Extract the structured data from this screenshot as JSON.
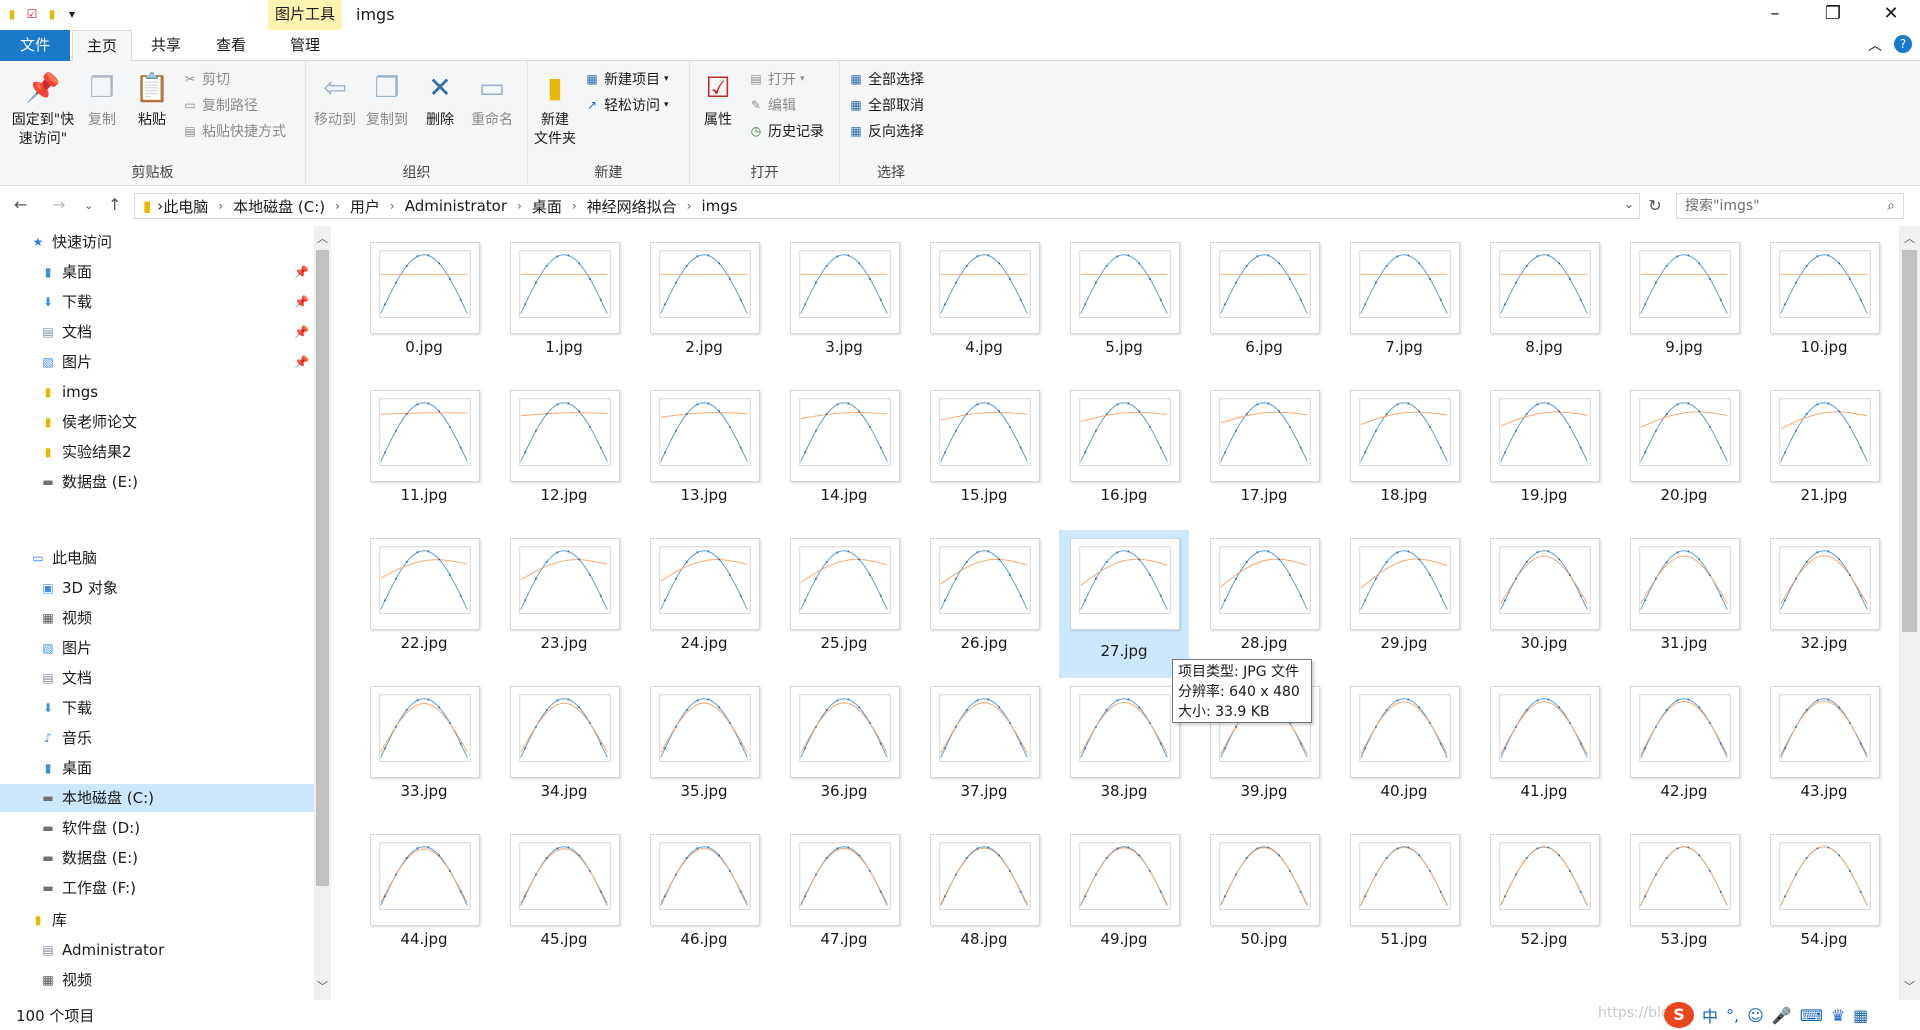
{
  "window": {
    "title": "imgs",
    "context_tab": "图片工具"
  },
  "tabs": {
    "file": "文件",
    "home": "主页",
    "share": "共享",
    "view": "查看",
    "manage": "管理"
  },
  "ribbon": {
    "clipboard": {
      "label": "剪贴板",
      "pin": "固定到\"快速访问\"",
      "copy": "复制",
      "paste": "粘贴",
      "cut": "剪切",
      "copy_path": "复制路径",
      "paste_shortcut": "粘贴快捷方式"
    },
    "organize": {
      "label": "组织",
      "move_to": "移动到",
      "copy_to": "复制到",
      "delete": "删除",
      "rename": "重命名"
    },
    "new": {
      "label": "新建",
      "new_folder": "新建\n文件夹",
      "new_item": "新建项目",
      "easy_access": "轻松访问"
    },
    "open": {
      "label": "打开",
      "properties": "属性",
      "open": "打开",
      "edit": "编辑",
      "history": "历史记录"
    },
    "select": {
      "label": "选择",
      "select_all": "全部选择",
      "select_none": "全部取消",
      "invert": "反向选择"
    }
  },
  "address": {
    "crumbs": [
      "此电脑",
      "本地磁盘 (C:)",
      "用户",
      "Administrator",
      "桌面",
      "神经网络拟合",
      "imgs"
    ],
    "search_placeholder": "搜索\"imgs\""
  },
  "nav": {
    "quick_access": "快速访问",
    "quick_items": [
      "桌面",
      "下载",
      "文档",
      "图片",
      "imgs",
      "侯老师论文",
      "实验结果2",
      "数据盘 (E:)"
    ],
    "this_pc": "此电脑",
    "pc_items": [
      "3D 对象",
      "视频",
      "图片",
      "文档",
      "下载",
      "音乐",
      "桌面",
      "本地磁盘 (C:)",
      "软件盘 (D:)",
      "数据盘 (E:)",
      "工作盘 (F:)"
    ],
    "library": "库",
    "lib_items": [
      "Administrator",
      "视频",
      "图片"
    ]
  },
  "files": [
    "0.jpg",
    "1.jpg",
    "2.jpg",
    "3.jpg",
    "4.jpg",
    "5.jpg",
    "6.jpg",
    "7.jpg",
    "8.jpg",
    "9.jpg",
    "10.jpg",
    "11.jpg",
    "12.jpg",
    "13.jpg",
    "14.jpg",
    "15.jpg",
    "16.jpg",
    "17.jpg",
    "18.jpg",
    "19.jpg",
    "20.jpg",
    "21.jpg",
    "22.jpg",
    "23.jpg",
    "24.jpg",
    "25.jpg",
    "26.jpg",
    "27.jpg",
    "28.jpg",
    "29.jpg",
    "30.jpg",
    "31.jpg",
    "32.jpg",
    "33.jpg",
    "34.jpg",
    "35.jpg",
    "36.jpg",
    "37.jpg",
    "38.jpg",
    "39.jpg",
    "40.jpg",
    "41.jpg",
    "42.jpg",
    "43.jpg",
    "44.jpg",
    "45.jpg",
    "46.jpg",
    "47.jpg",
    "48.jpg",
    "49.jpg",
    "50.jpg",
    "51.jpg",
    "52.jpg",
    "53.jpg",
    "54.jpg"
  ],
  "selected_file": "27.jpg",
  "tooltip": {
    "type": "项目类型: JPG 文件",
    "resolution": "分辨率: 640 x 480",
    "size": "大小: 33.9 KB"
  },
  "status": {
    "count": "100 个项目",
    "watermark": "https://blog.",
    "ime": "中"
  },
  "colors": {
    "accent": "#1979ca",
    "selection": "#cce8ff",
    "series_fit": "#f5a86b",
    "series_data": "#5b9bd5"
  }
}
